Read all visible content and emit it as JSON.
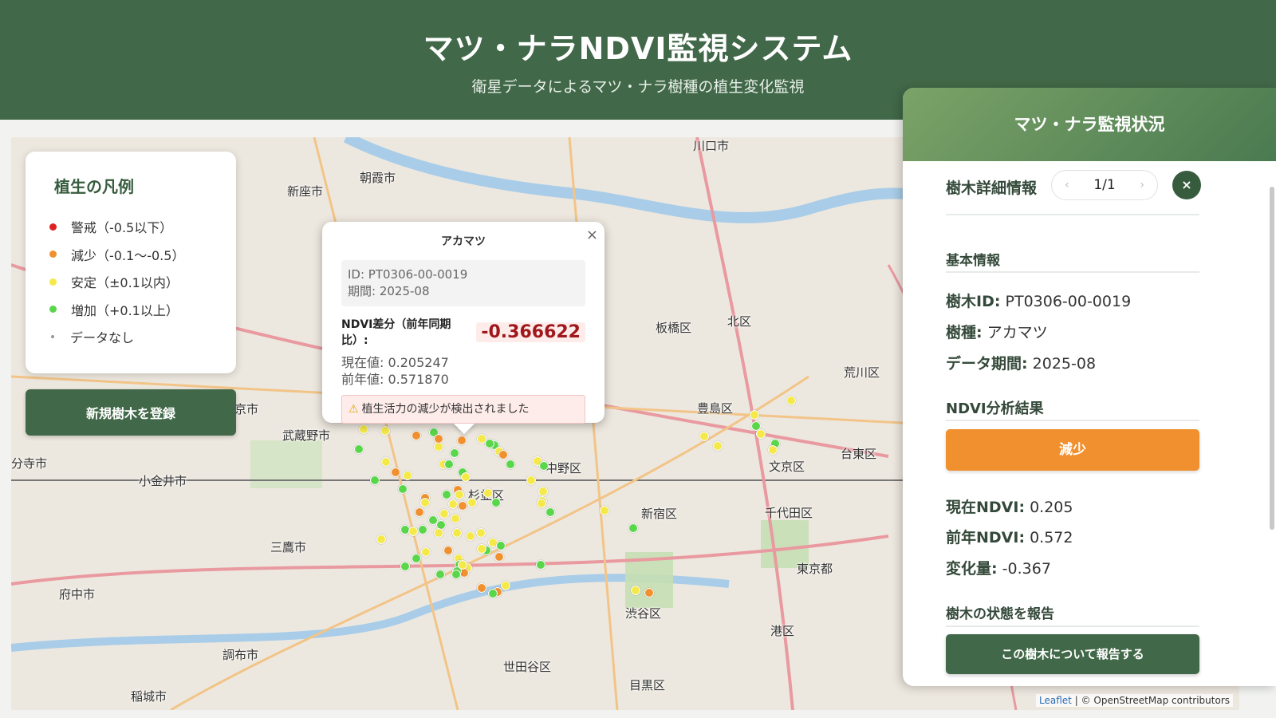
{
  "header": {
    "title": "マツ・ナラNDVI監視システム",
    "subtitle": "衛星データによるマツ・ナラ樹種の植生変化監視"
  },
  "legend": {
    "title": "植生の凡例",
    "items": [
      {
        "label": "警戒（-0.5以下）",
        "color": "#e02020"
      },
      {
        "label": "減少（-0.1〜-0.5）",
        "color": "#f0902e"
      },
      {
        "label": "安定（±0.1以内）",
        "color": "#f5e94a"
      },
      {
        "label": "増加（+0.1以上）",
        "color": "#5ad64a"
      },
      {
        "label": "データなし",
        "color": "#999999"
      }
    ]
  },
  "register_button": "新規樹木を登録",
  "map": {
    "labels": [
      {
        "text": "川口市"
      },
      {
        "text": "朝霞市"
      },
      {
        "text": "新座市"
      },
      {
        "text": "板橋区"
      },
      {
        "text": "北区"
      },
      {
        "text": "荒川区"
      },
      {
        "text": "豊島区"
      },
      {
        "text": "武蔵野市"
      },
      {
        "text": "中野区"
      },
      {
        "text": "文京区"
      },
      {
        "text": "台東区"
      },
      {
        "text": "小金井市"
      },
      {
        "text": "杉並区"
      },
      {
        "text": "新宿区"
      },
      {
        "text": "千代田区"
      },
      {
        "text": "三鷹市"
      },
      {
        "text": "府中市"
      },
      {
        "text": "東京都"
      },
      {
        "text": "渋谷区"
      },
      {
        "text": "港区"
      },
      {
        "text": "調布市"
      },
      {
        "text": "世田谷区"
      },
      {
        "text": "目黒区"
      },
      {
        "text": "稲城市"
      },
      {
        "text": "分寺市"
      },
      {
        "text": "京市"
      }
    ],
    "attribution_leaflet": "Leaflet",
    "attribution_rest": "| © OpenStreetMap contributors"
  },
  "popup": {
    "species": "アカマツ",
    "close": "×",
    "id_line": "ID: PT0306-00-0019",
    "period_line": "期間: 2025-08",
    "diff_label": "NDVI差分（前年同期比）:",
    "diff_value": "-0.366622",
    "current_line": "現在値: 0.205247",
    "previous_line": "前年値: 0.571870",
    "alert": "植生活力の減少が検出されました"
  },
  "panel": {
    "title": "マツ・ナラ監視状況",
    "detail_title": "樹木詳細情報",
    "pager": "1/1",
    "prev": "‹",
    "next": "›",
    "close": "×",
    "basic_title": "基本情報",
    "tree_id_label": "樹木ID:",
    "tree_id": "PT0306-00-0019",
    "species_label": "樹種:",
    "species": "アカマツ",
    "period_label": "データ期間:",
    "period": "2025-08",
    "ndvi_title": "NDVI分析結果",
    "status": "減少",
    "current_label": "現在NDVI:",
    "current": "0.205",
    "previous_label": "前年NDVI:",
    "previous": "0.572",
    "change_label": "変化量:",
    "change": "-0.367",
    "report_title": "樹木の状態を報告",
    "report_button": "この樹木について報告する"
  },
  "markers": [
    {
      "status": "stable"
    },
    {
      "status": "stable"
    },
    {
      "status": "decrease"
    },
    {
      "status": "increase"
    },
    {
      "status": "decrease"
    },
    {
      "status": "stable"
    },
    {
      "status": "increase"
    },
    {
      "status": "decrease"
    },
    {
      "status": "decrease"
    },
    {
      "status": "stable"
    },
    {
      "status": "increase"
    },
    {
      "status": "stable"
    },
    {
      "status": "increase"
    },
    {
      "status": "decrease"
    },
    {
      "status": "stable"
    },
    {
      "status": "increase"
    },
    {
      "status": "increase"
    },
    {
      "status": "stable"
    },
    {
      "status": "decrease"
    },
    {
      "status": "increase"
    },
    {
      "status": "stable"
    },
    {
      "status": "increase"
    },
    {
      "status": "decrease"
    },
    {
      "status": "increase"
    },
    {
      "status": "stable"
    },
    {
      "status": "increase"
    },
    {
      "status": "increase"
    },
    {
      "status": "stable"
    },
    {
      "status": "decrease"
    },
    {
      "status": "stable"
    },
    {
      "status": "increase"
    },
    {
      "status": "stable"
    },
    {
      "status": "stable"
    },
    {
      "status": "decrease"
    },
    {
      "status": "increase"
    },
    {
      "status": "stable"
    },
    {
      "status": "stable"
    },
    {
      "status": "decrease"
    },
    {
      "status": "stable"
    },
    {
      "status": "increase"
    },
    {
      "status": "stable"
    },
    {
      "status": "increase"
    },
    {
      "status": "increase"
    },
    {
      "status": "stable"
    },
    {
      "status": "increase"
    },
    {
      "status": "stable"
    },
    {
      "status": "stable"
    },
    {
      "status": "stable"
    },
    {
      "status": "stable"
    },
    {
      "status": "stable"
    },
    {
      "status": "increase"
    },
    {
      "status": "increase"
    },
    {
      "status": "decrease"
    },
    {
      "status": "stable"
    },
    {
      "status": "decrease"
    },
    {
      "status": "stable"
    },
    {
      "status": "increase"
    },
    {
      "status": "stable"
    },
    {
      "status": "decrease"
    },
    {
      "status": "increase"
    },
    {
      "status": "stable"
    },
    {
      "status": "increase"
    },
    {
      "status": "decrease"
    },
    {
      "status": "decrease"
    },
    {
      "status": "stable"
    },
    {
      "status": "increase"
    },
    {
      "status": "stable"
    },
    {
      "status": "increase"
    },
    {
      "status": "increase"
    },
    {
      "status": "increase"
    },
    {
      "status": "stable"
    },
    {
      "status": "increase"
    },
    {
      "status": "stable"
    },
    {
      "status": "stable"
    },
    {
      "status": "stable"
    },
    {
      "status": "increase"
    },
    {
      "status": "stable"
    },
    {
      "status": "stable"
    },
    {
      "status": "increase"
    },
    {
      "status": "stable"
    },
    {
      "status": "decrease"
    },
    {
      "status": "stable"
    },
    {
      "status": "stable"
    },
    {
      "status": "stable"
    },
    {
      "status": "stable"
    },
    {
      "status": "increase"
    },
    {
      "status": "stable"
    },
    {
      "status": "increase"
    },
    {
      "status": "stable"
    }
  ],
  "colors": {
    "decrease": "#f0902e",
    "stable": "#f5e94a",
    "increase": "#5ad64a",
    "alert": "#e02020",
    "primary": "#416848"
  }
}
